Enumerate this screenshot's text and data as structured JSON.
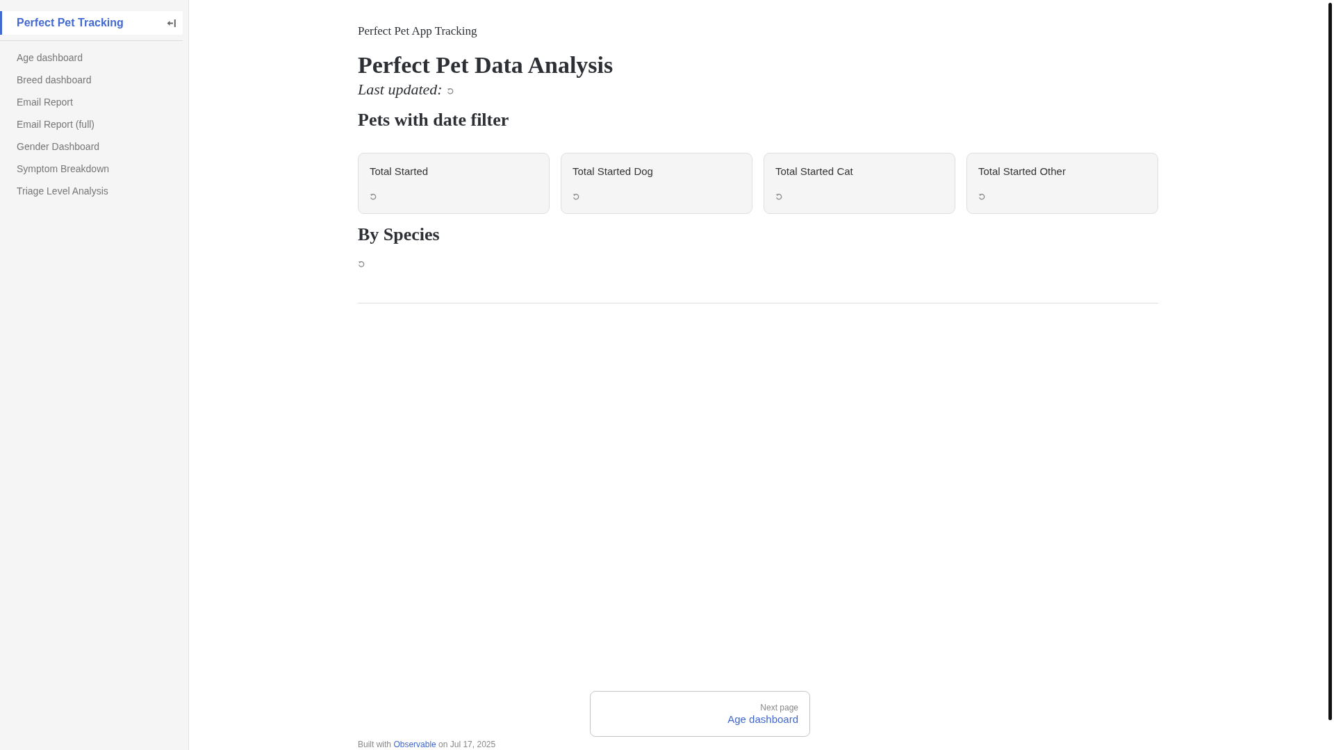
{
  "sidebar": {
    "home": {
      "label": "Perfect Pet Tracking",
      "selected": true
    },
    "items": [
      {
        "label": "Age dashboard",
        "selected": false
      },
      {
        "label": "Breed dashboard",
        "selected": false
      },
      {
        "label": "Email Report",
        "selected": false
      },
      {
        "label": "Email Report (full)",
        "selected": false
      },
      {
        "label": "Gender Dashboard",
        "selected": false
      },
      {
        "label": "Symptom Breakdown",
        "selected": false
      },
      {
        "label": "Triage Level Analysis",
        "selected": false
      }
    ]
  },
  "page": {
    "kicker": "Perfect Pet App Tracking",
    "title": "Perfect Pet Data Analysis",
    "updated_label": "Last updated:"
  },
  "sections": [
    {
      "kind": "cards",
      "heading": "Pets with date filter",
      "cards": [
        {
          "title": "Total Started"
        },
        {
          "title": "Total Started Dog"
        },
        {
          "title": "Total Started Cat"
        },
        {
          "title": "Total Started Other"
        }
      ]
    },
    {
      "kind": "loading",
      "heading": "By Species"
    }
  ],
  "pager": {
    "label": "Next page",
    "link": "Age dashboard"
  },
  "footer": {
    "prefix": "Built with",
    "link": "Observable",
    "suffix": "on Jul 17, 2025"
  }
}
